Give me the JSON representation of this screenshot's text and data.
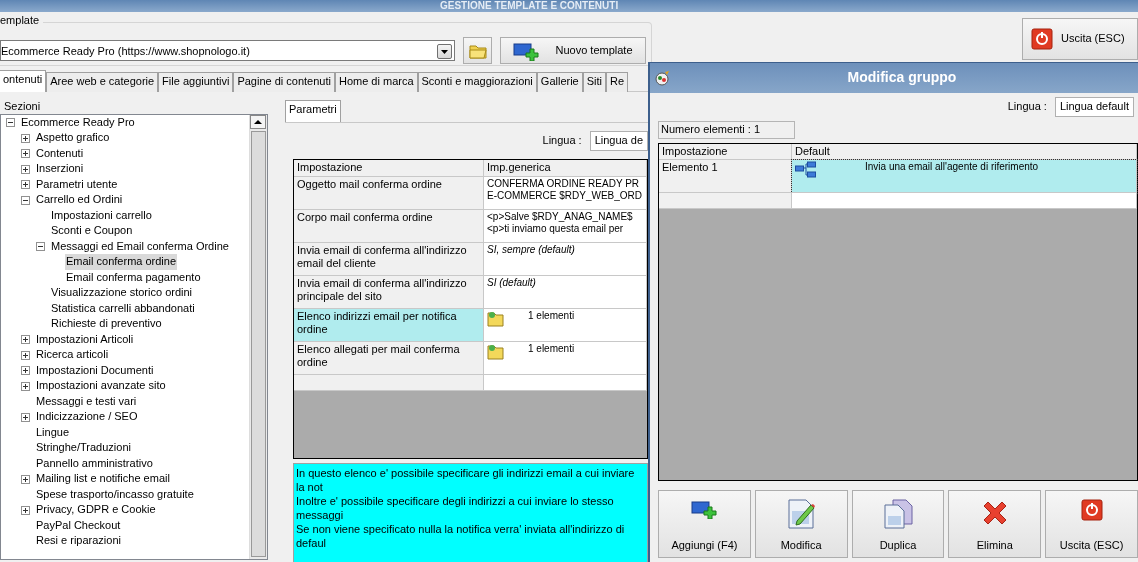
{
  "window": {
    "title": "GESTIONE TEMPLATE E CONTENUTI"
  },
  "template": {
    "label": "emplate",
    "value": "Ecommerce Ready Pro (https://www.shopnologo.it)",
    "new_button": "Nuovo template"
  },
  "exit_button": {
    "label": "Uscita (ESC)"
  },
  "tabs": [
    {
      "label": "ontenuti",
      "selected": true
    },
    {
      "label": "Aree web e categorie",
      "selected": false
    },
    {
      "label": "File aggiuntivi",
      "selected": false
    },
    {
      "label": "Pagine di contenuti",
      "selected": false
    },
    {
      "label": "Home di marca",
      "selected": false
    },
    {
      "label": "Sconti e maggiorazioni",
      "selected": false
    },
    {
      "label": "Gallerie",
      "selected": false
    },
    {
      "label": "Siti",
      "selected": false
    },
    {
      "label": "Re",
      "selected": false
    }
  ],
  "sections": {
    "label": "Sezioni",
    "tree": [
      {
        "label": "Ecommerce Ready Pro",
        "expanded": true,
        "selected": false,
        "children": [
          {
            "label": "Aspetto grafico",
            "expanded": false,
            "selected": false
          },
          {
            "label": "Contenuti",
            "expanded": false,
            "selected": false
          },
          {
            "label": "Inserzioni",
            "expanded": false,
            "selected": false
          },
          {
            "label": "Parametri utente",
            "expanded": false,
            "selected": false
          },
          {
            "label": "Carrello ed Ordini",
            "expanded": true,
            "selected": false,
            "children": [
              {
                "label": "Impostazioni carrello",
                "selected": false
              },
              {
                "label": "Sconti e Coupon",
                "selected": false
              },
              {
                "label": "Messaggi ed Email conferma Ordine",
                "expanded": true,
                "selected": false,
                "children": [
                  {
                    "label": "Email conferma ordine",
                    "selected": true
                  },
                  {
                    "label": "Email conferma pagamento",
                    "selected": false
                  }
                ]
              },
              {
                "label": "Visualizzazione storico ordini",
                "selected": false
              },
              {
                "label": "Statistica carrelli abbandonati",
                "selected": false
              },
              {
                "label": "Richieste di preventivo",
                "selected": false
              }
            ]
          },
          {
            "label": "Impostazioni Articoli",
            "expanded": false,
            "selected": false
          },
          {
            "label": "Ricerca articoli",
            "expanded": false,
            "selected": false
          },
          {
            "label": "Impostazioni Documenti",
            "expanded": false,
            "selected": false
          },
          {
            "label": "Impostazioni avanzate sito",
            "expanded": false,
            "selected": false
          },
          {
            "label": "Messaggi e testi vari",
            "selected": false
          },
          {
            "label": "Indicizzazione / SEO",
            "expanded": false,
            "selected": false
          },
          {
            "label": "Lingue",
            "selected": false
          },
          {
            "label": "Stringhe/Traduzioni",
            "selected": false
          },
          {
            "label": "Pannello amministrativo",
            "selected": false
          },
          {
            "label": "Mailing list e notifiche email",
            "expanded": false,
            "selected": false
          },
          {
            "label": "Spese trasporto/incasso gratuite",
            "selected": false
          },
          {
            "label": "Privacy, GDPR e Cookie",
            "expanded": false,
            "selected": false
          },
          {
            "label": "PayPal Checkout",
            "selected": false
          },
          {
            "label": "Resi e riparazioni",
            "selected": false
          }
        ]
      }
    ]
  },
  "parameters": {
    "tab": "Parametri",
    "language_label": "Lingua :",
    "language_value": "Lingua de",
    "columns": [
      "Impostazione",
      "Imp.generica"
    ],
    "rows": [
      {
        "setting": "Oggetto mail conferma ordine",
        "value": "CONFERMA ORDINE READY PR\nE-COMMERCE $RDY_WEB_ORD",
        "kind": "text",
        "selected": false
      },
      {
        "setting": "Corpo mail conferma ordine",
        "value": "<p>Salve $RDY_ANAG_NAME$\n<p>ti inviamo questa email per",
        "kind": "text",
        "selected": false
      },
      {
        "setting": "Invia email di conferma all'indirizzo email del cliente",
        "value": "SI, sempre (default)",
        "kind": "italic",
        "selected": false
      },
      {
        "setting": "Invia email di conferma all'indirizzo principale del sito",
        "value": "SI (default)",
        "kind": "italic",
        "selected": false
      },
      {
        "setting": "Elenco indirizzi email per notifica ordine",
        "value": "1 elementi",
        "kind": "list",
        "selected": true
      },
      {
        "setting": "Elenco allegati per mail conferma ordine",
        "value": "1 elementi",
        "kind": "list",
        "selected": false
      }
    ],
    "help": "In questo elenco e' possibile specificare gli indirizzi email a cui inviare la not\nInoltre e' possibile specificare degli indirizzi a cui inviare lo stesso messaggi\nSe non viene specificato nulla la notifica verra' inviata all'indirizzo di defaul"
  },
  "dialog": {
    "title": "Modifica gruppo",
    "language_label": "Lingua :",
    "language_value": "Lingua default",
    "count": "Numero elementi : 1",
    "columns": [
      "Impostazione",
      "Default"
    ],
    "rows": [
      {
        "setting": "Elemento 1",
        "value": "Invia una email all'agente di riferimento",
        "selected": true
      }
    ],
    "buttons": [
      {
        "label": "Aggiungi (F4)",
        "kind": "add"
      },
      {
        "label": "Modifica",
        "kind": "edit"
      },
      {
        "label": "Duplica",
        "kind": "duplicate"
      },
      {
        "label": "Elimina",
        "kind": "delete"
      },
      {
        "label": "Uscita (ESC)",
        "kind": "exit"
      }
    ]
  }
}
